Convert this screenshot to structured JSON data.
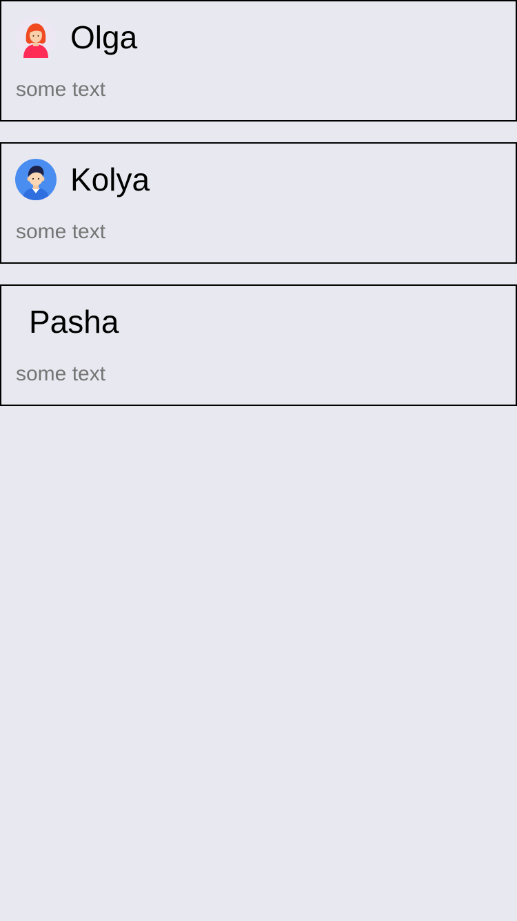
{
  "contacts": [
    {
      "name": "Olga",
      "text": "some text",
      "avatar_icon": "female-avatar-icon"
    },
    {
      "name": "Kolya",
      "text": "some text",
      "avatar_icon": "male-avatar-icon"
    },
    {
      "name": "Pasha",
      "text": "some text",
      "avatar_icon": null
    }
  ],
  "colors": {
    "background": "#e8e8f0",
    "card_border": "#000000",
    "name_text": "#000000",
    "sub_text": "#757575"
  }
}
